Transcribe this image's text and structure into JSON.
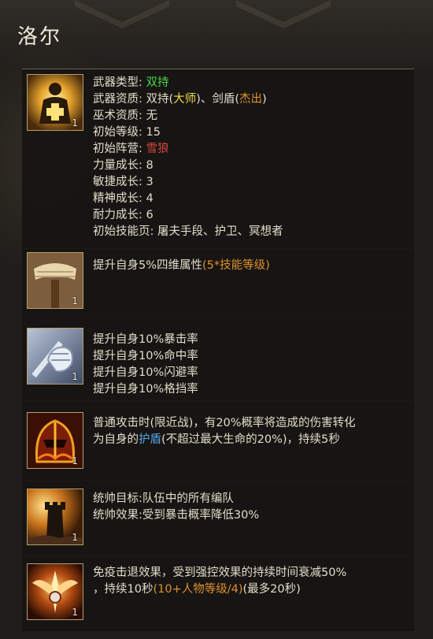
{
  "title": "洛尔",
  "header": {
    "icon": "hero-class-icon",
    "level": "1",
    "rows": [
      {
        "label": "武器类型",
        "sep": ": ",
        "parts": [
          {
            "t": "双持",
            "c": "green"
          }
        ]
      },
      {
        "label": "武器资质",
        "sep": ": ",
        "parts": [
          {
            "t": "双持(",
            "c": ""
          },
          {
            "t": "大师",
            "c": "yellow"
          },
          {
            "t": ")、剑盾(",
            "c": ""
          },
          {
            "t": "杰出",
            "c": "orange"
          },
          {
            "t": ")",
            "c": ""
          }
        ]
      },
      {
        "label": "巫术资质",
        "sep": ": ",
        "parts": [
          {
            "t": "无",
            "c": ""
          }
        ]
      },
      {
        "label": "初始等级",
        "sep": ": ",
        "parts": [
          {
            "t": "15",
            "c": ""
          }
        ]
      },
      {
        "label": "初始阵营",
        "sep": ": ",
        "parts": [
          {
            "t": "雪狼",
            "c": "red"
          }
        ]
      },
      {
        "label": "力量成长",
        "sep": ": ",
        "parts": [
          {
            "t": "8",
            "c": ""
          }
        ]
      },
      {
        "label": "敏捷成长",
        "sep": ": ",
        "parts": [
          {
            "t": "3",
            "c": ""
          }
        ]
      },
      {
        "label": "精神成长",
        "sep": ": ",
        "parts": [
          {
            "t": "4",
            "c": ""
          }
        ]
      },
      {
        "label": "耐力成长",
        "sep": ": ",
        "parts": [
          {
            "t": "6",
            "c": ""
          }
        ]
      },
      {
        "label": "初始技能页",
        "sep": ": ",
        "parts": [
          {
            "t": "屠夫手段、护卫、冥想者",
            "c": ""
          }
        ]
      }
    ]
  },
  "skills": [
    {
      "icon": "bandaged-arm-icon",
      "level": "1",
      "lines": [
        [
          {
            "t": "提升自身5%四维属性",
            "c": ""
          },
          {
            "t": "(5*技能等级)",
            "c": "orange"
          }
        ]
      ]
    },
    {
      "icon": "gauntlet-fist-icon",
      "level": "1",
      "lines": [
        [
          {
            "t": "提升自身10%暴击率",
            "c": ""
          }
        ],
        [
          {
            "t": "提升自身10%命中率",
            "c": ""
          }
        ],
        [
          {
            "t": "提升自身10%闪避率",
            "c": ""
          }
        ],
        [
          {
            "t": "提升自身10%格挡率",
            "c": ""
          }
        ]
      ]
    },
    {
      "icon": "fiery-helmet-icon",
      "level": "1",
      "lines": [
        [
          {
            "t": "普通攻击时(限近战)，有20%概率将造成的伤害转化",
            "c": ""
          }
        ],
        [
          {
            "t": "为自身的",
            "c": ""
          },
          {
            "t": "护盾",
            "c": "blue"
          },
          {
            "t": "(不超过最大生命的20%)，持续5秒",
            "c": ""
          }
        ]
      ]
    },
    {
      "icon": "watchtower-icon",
      "level": "1",
      "lines": [
        [
          {
            "t": "统帅目标:队伍中的所有编队",
            "c": ""
          }
        ],
        [
          {
            "t": "统帅效果:受到暴击概率降低30%",
            "c": ""
          }
        ]
      ]
    },
    {
      "icon": "winged-emblem-icon",
      "level": "1",
      "lines": [
        [
          {
            "t": "免疫击退效果，受到强控效果的持续时间衰减50%",
            "c": ""
          }
        ],
        [
          {
            "t": "，持续10秒",
            "c": ""
          },
          {
            "t": "(10+人物等级/4)",
            "c": "orange"
          },
          {
            "t": "(最多20秒)",
            "c": ""
          }
        ]
      ]
    }
  ]
}
